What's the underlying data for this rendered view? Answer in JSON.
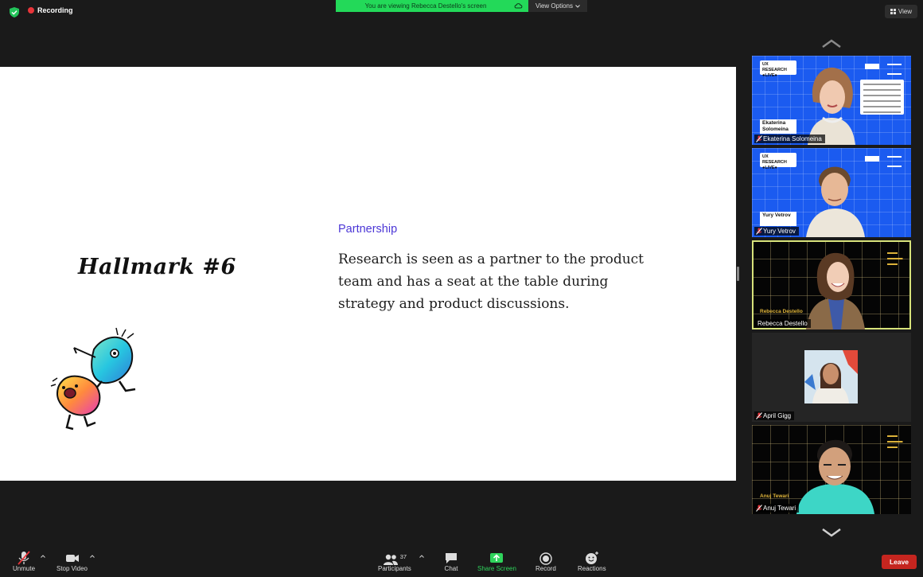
{
  "top_bar": {
    "recording_label": "Recording",
    "viewing_banner": "You are viewing Rebecca Destello's screen",
    "view_options_label": "View Options",
    "view_button_label": "View",
    "colors": {
      "banner_bg": "#23d959",
      "recording_dot": "#e8353a"
    }
  },
  "slide": {
    "hallmark_title": "Hallmark #6",
    "section_label": "Partnership",
    "body": "Research is seen as a partner to the product team and has a seat at the table during strategy and product discussions.",
    "colors": {
      "section_label": "#4b36d6"
    }
  },
  "gallery": {
    "participants": [
      {
        "name": "Ekaterina Solomeina",
        "nameplate": "Ekaterina Solomeina",
        "muted": true,
        "background": "blue",
        "logo": "UX RESEARCH ●LIVE●"
      },
      {
        "name": "Yury Vetrov",
        "nameplate": "Yury Vetrov",
        "muted": true,
        "background": "blue",
        "logo": "UX RESEARCH ●LIVE●"
      },
      {
        "name": "Rebecca Destello",
        "nameplate": "Rebecca Destello",
        "muted": false,
        "active_speaker": true,
        "background": "black"
      },
      {
        "name": "April Gigg",
        "muted": true,
        "video_off": true
      },
      {
        "name": "Anuj Tewari",
        "nameplate": "Anuj Tewari",
        "muted": true,
        "background": "black"
      }
    ]
  },
  "toolbar": {
    "unmute_label": "Unmute",
    "stop_video_label": "Stop Video",
    "participants_label": "Participants",
    "participants_count": "37",
    "chat_label": "Chat",
    "share_screen_label": "Share Screen",
    "record_label": "Record",
    "reactions_label": "Reactions",
    "leave_label": "Leave",
    "colors": {
      "share": "#2fd45c",
      "leave": "#c5251f"
    }
  }
}
